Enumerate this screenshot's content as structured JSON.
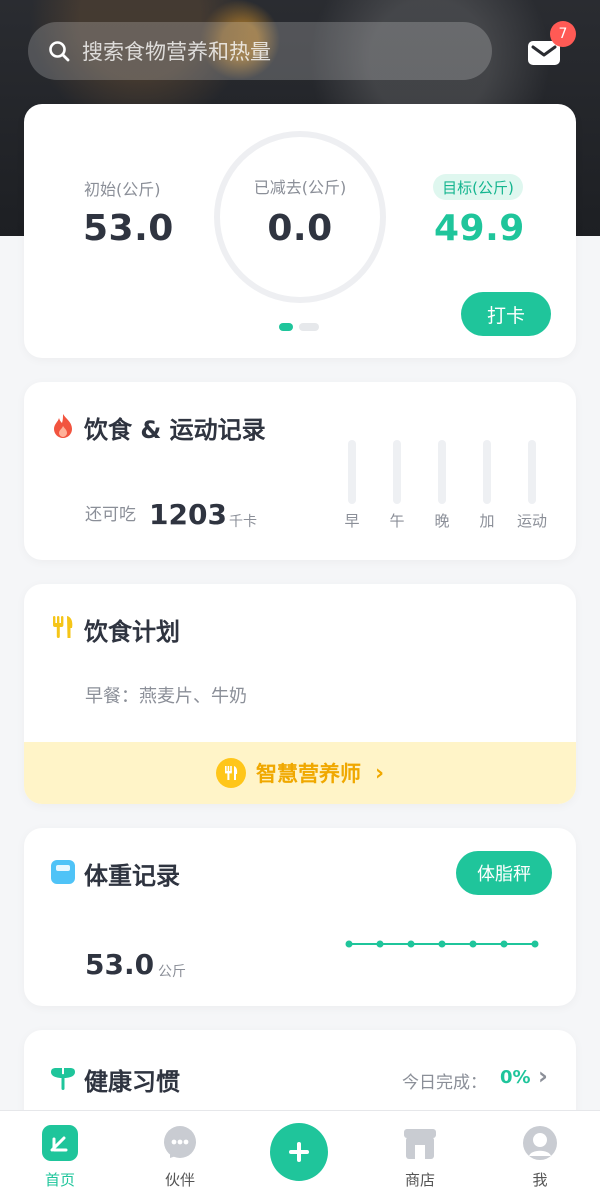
{
  "search": {
    "placeholder": "搜索食物营养和热量"
  },
  "mail": {
    "badge": "7"
  },
  "weight_summary": {
    "initial_label": "初始(公斤)",
    "initial_value": "53.0",
    "lost_label": "已减去(公斤)",
    "lost_value": "0.0",
    "goal_label": "目标(公斤)",
    "goal_value": "49.9",
    "checkin_button": "打卡"
  },
  "diet_exercise": {
    "title": "饮食 & 运动记录",
    "remaining_label": "还可吃",
    "remaining_value": "1203",
    "remaining_unit": "千卡",
    "meals": [
      "早",
      "午",
      "晚",
      "加",
      "运动"
    ]
  },
  "diet_plan": {
    "title": "饮食计划",
    "breakfast": "早餐：燕麦片、牛奶",
    "nutritionist": "智慧营养师",
    "arrow": "›"
  },
  "weight_record": {
    "title": "体重记录",
    "scale_button": "体脂秤",
    "value": "53.0",
    "unit": "公斤"
  },
  "habits": {
    "title": "健康习惯",
    "progress_label": "今日完成：",
    "progress_value": "0%",
    "arrow": "›"
  },
  "tabbar": {
    "home": "首页",
    "partner": "伙伴",
    "shop": "商店",
    "me": "我"
  },
  "colors": {
    "accent": "#1fc59b",
    "badge": "#ff5a55",
    "banner": "#fff4c8",
    "banner_text": "#f0a800"
  }
}
